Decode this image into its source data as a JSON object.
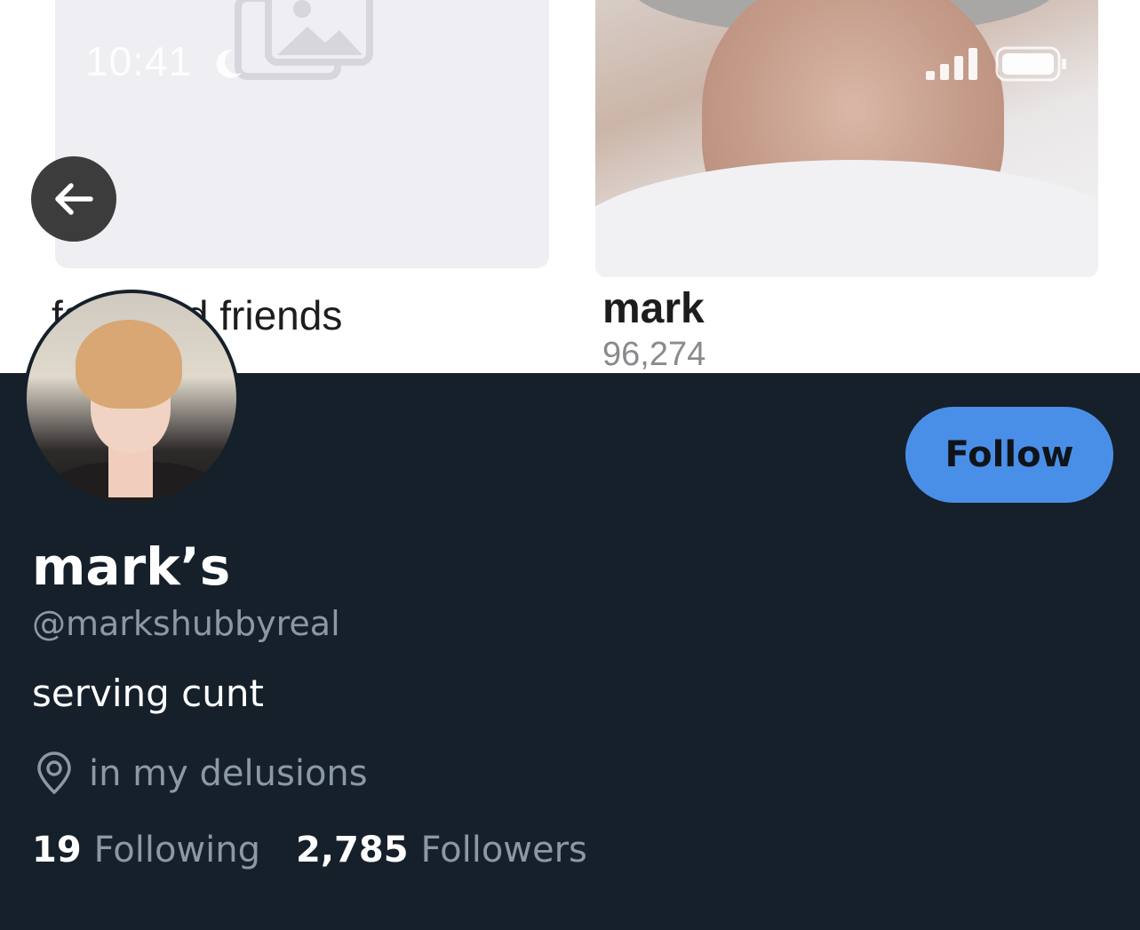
{
  "status_bar": {
    "time": "10:41"
  },
  "banner": {
    "left_caption": "fans and friends",
    "right_caption": "mark",
    "right_count": "96,274"
  },
  "profile": {
    "follow_label": "Follow",
    "display_name": "mark’s",
    "handle": "@markshubbyreal",
    "bio": "serving cunt",
    "location": "in my delusions",
    "following_count": "19",
    "following_label": "Following",
    "followers_count": "2,785",
    "followers_label": "Followers"
  },
  "colors": {
    "background": "#15202b",
    "accent": "#4a8fe7",
    "secondary_text": "#8b98a5"
  }
}
